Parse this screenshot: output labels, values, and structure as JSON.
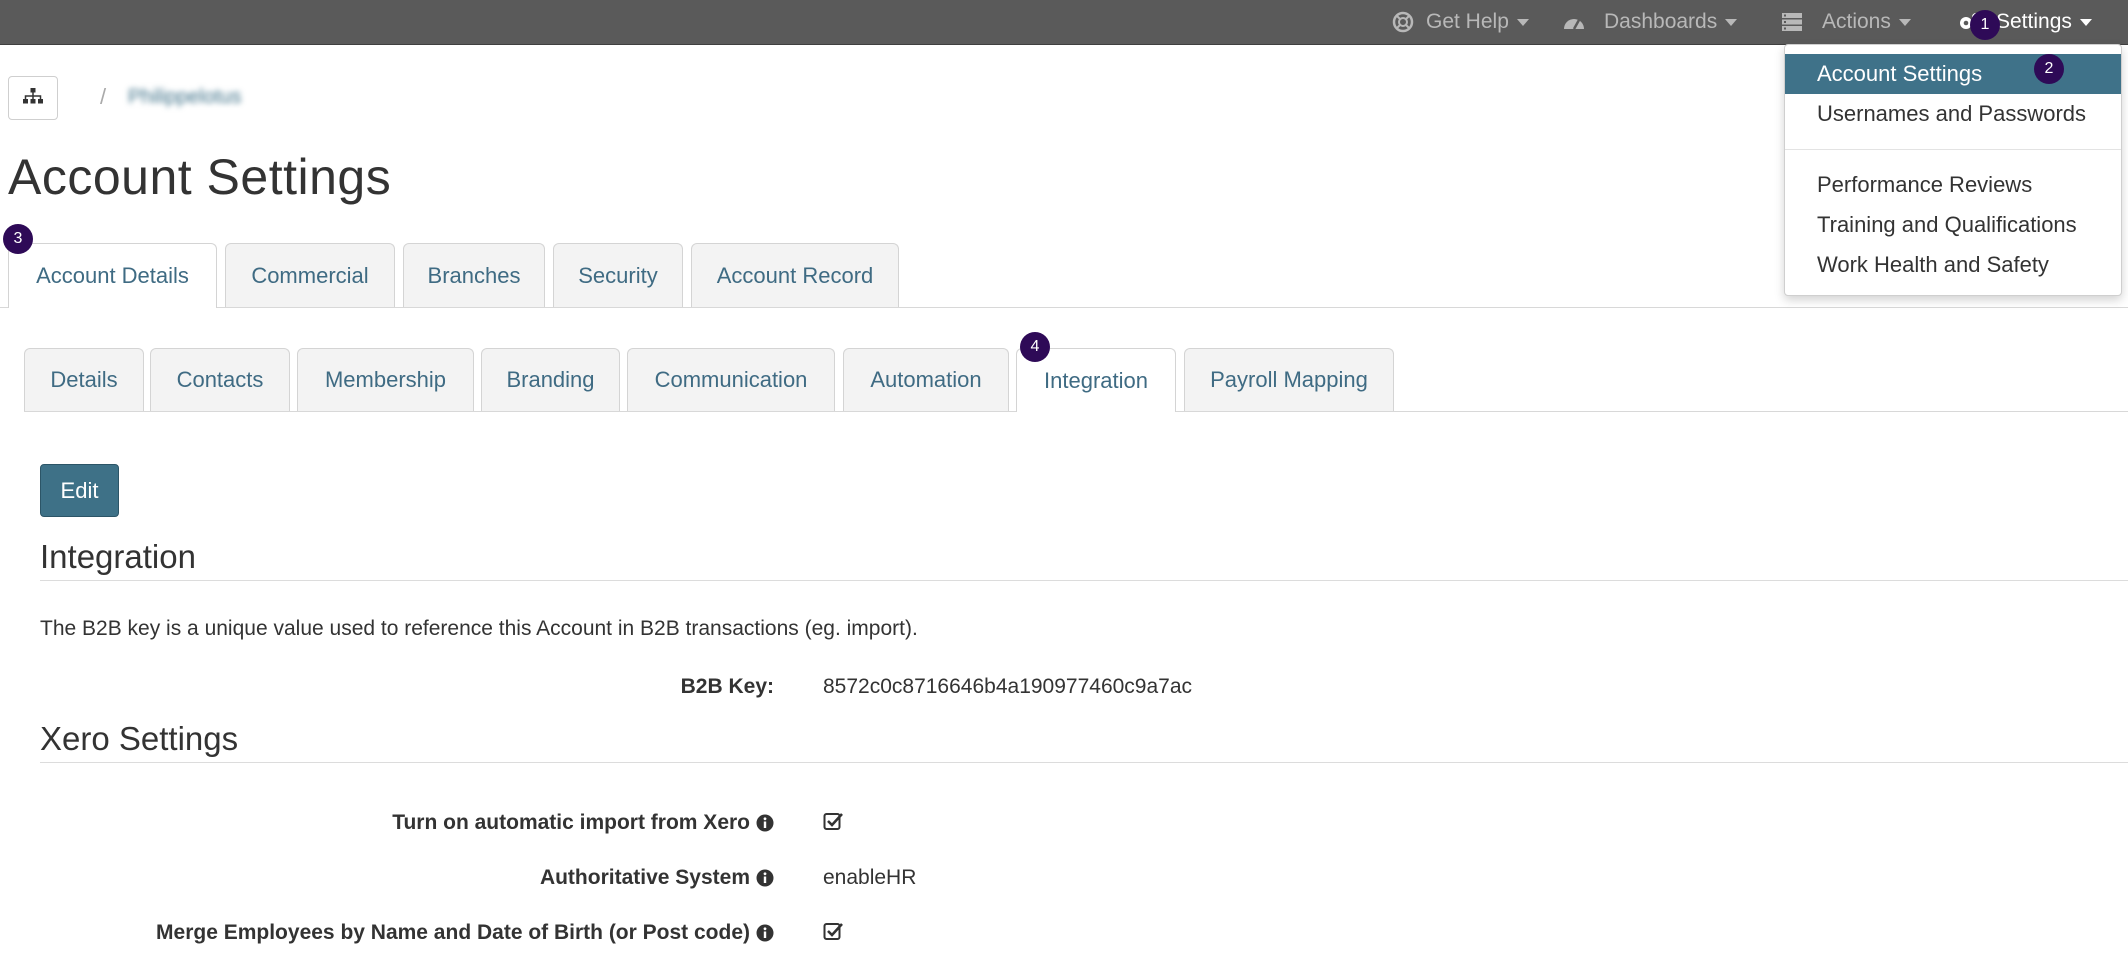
{
  "topnav": {
    "get_help": "Get Help",
    "dashboards": "Dashboards",
    "actions": "Actions",
    "settings": "Settings"
  },
  "settings_menu": {
    "items": [
      {
        "label": "Account Settings",
        "active": true
      },
      {
        "label": "Usernames and Passwords"
      },
      {
        "label": "Performance Reviews"
      },
      {
        "label": "Training and Qualifications"
      },
      {
        "label": "Work Health and Safety"
      }
    ]
  },
  "breadcrumb": {
    "separator": "/",
    "account_name": "Philippelotus"
  },
  "page": {
    "title": "Account Settings"
  },
  "primary_tabs": [
    {
      "label": "Account Details",
      "active": true
    },
    {
      "label": "Commercial"
    },
    {
      "label": "Branches"
    },
    {
      "label": "Security"
    },
    {
      "label": "Account Record"
    }
  ],
  "secondary_tabs": [
    {
      "label": "Details"
    },
    {
      "label": "Contacts"
    },
    {
      "label": "Membership"
    },
    {
      "label": "Branding"
    },
    {
      "label": "Communication"
    },
    {
      "label": "Automation"
    },
    {
      "label": "Integration",
      "active": true
    },
    {
      "label": "Payroll Mapping"
    }
  ],
  "edit_label": "Edit",
  "integration": {
    "heading": "Integration",
    "description": "The B2B key is a unique value used to reference this Account in B2B transactions (eg. import).",
    "b2b_key_label": "B2B Key:",
    "b2b_key_value": "8572c0c8716646b4a190977460c9a7ac"
  },
  "xero": {
    "heading": "Xero Settings",
    "fields": [
      {
        "label": "Turn on automatic import from Xero",
        "value": "checked"
      },
      {
        "label": "Authoritative System",
        "value": "enableHR"
      },
      {
        "label": "Merge Employees by Name and Date of Birth (or Post code)",
        "value": "checked"
      }
    ]
  },
  "annotations": [
    "1",
    "2",
    "3",
    "4"
  ],
  "colors": {
    "topbar": "#5a5a5a",
    "accent": "#3f7289",
    "badge": "#2e0a57",
    "link": "#3f6b83"
  }
}
